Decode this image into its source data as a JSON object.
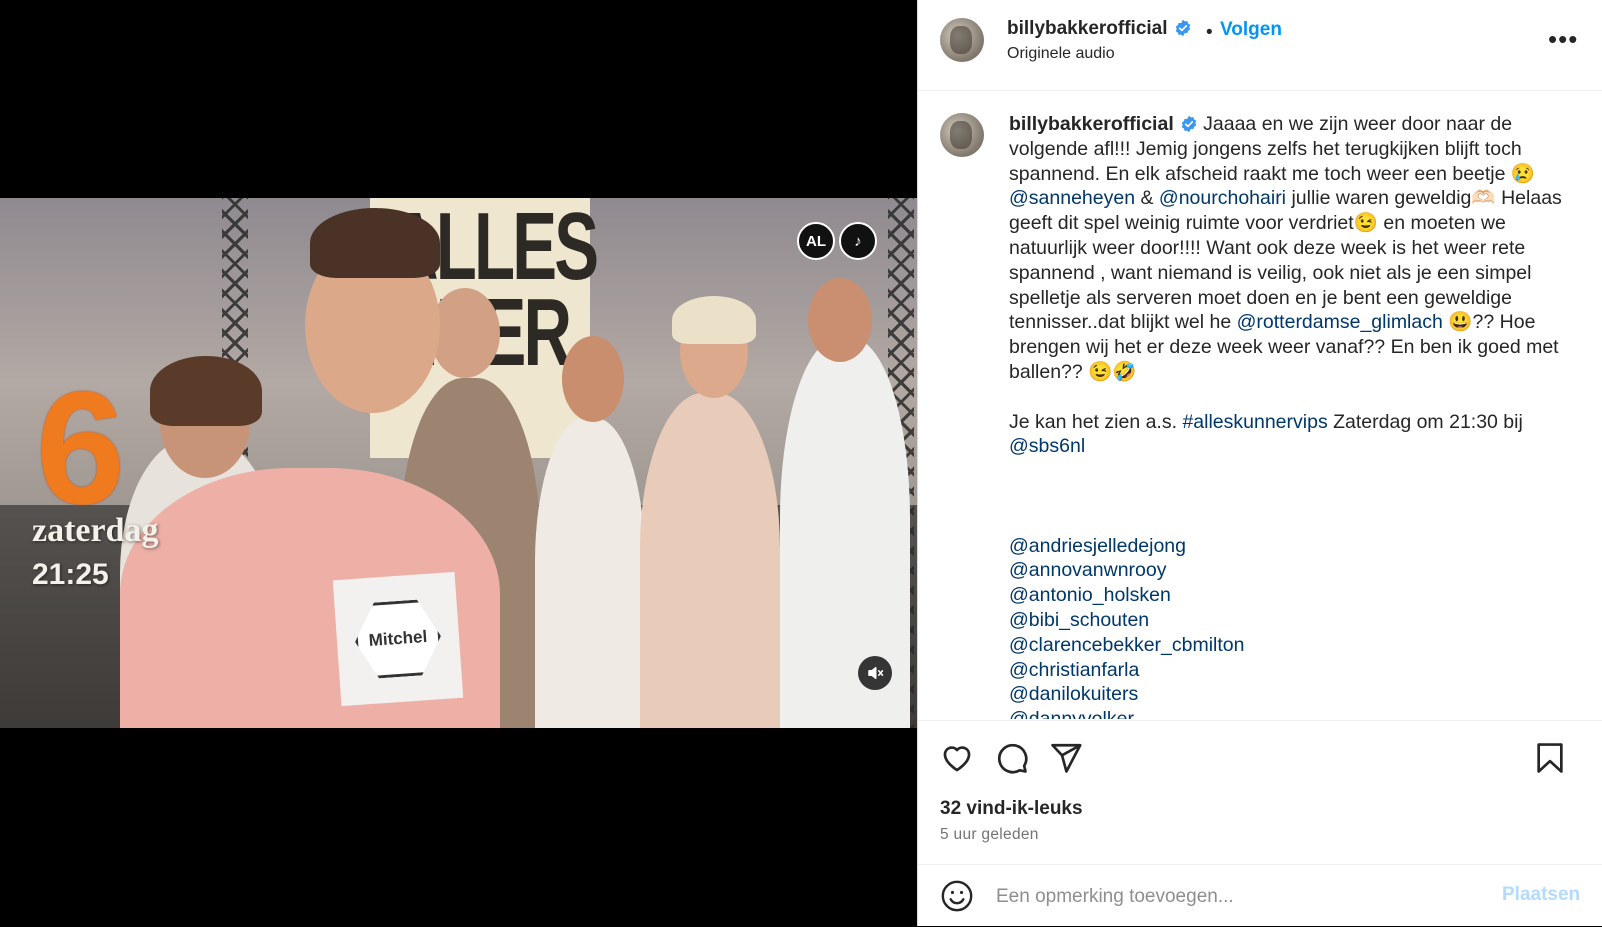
{
  "post": {
    "username": "billybakkerofficial",
    "separator": "•",
    "follow_label": "Volgen",
    "audio_label": "Originele audio",
    "more_label": "•••"
  },
  "video": {
    "channel_number": "6",
    "airing_day": "zaterdag",
    "airing_time": "21:25",
    "badge_left": "AL",
    "badge_right": "♪",
    "sign_text": "ALLES\nNNER",
    "name_tag": "Mitchel"
  },
  "caption": {
    "username": "billybakkerofficial",
    "p1": " Jaaaa en we zijn weer door naar de volgende afl!!! Jemig jongens zelfs het terugkijken blijft toch spannend. En elk afscheid raakt me toch weer een beetje 😢",
    "m1": "@sanneheyen",
    "amp": " & ",
    "m2": "@nourchohairi",
    "p2": " jullie waren geweldig🫶🏻 Helaas geeft dit spel weinig ruimte voor verdriet😉 en moeten we natuurlijk weer door!!!! Want ook deze week is het weer rete spannend , want niemand is veilig, ook niet als je een simpel spelletje als serveren moet doen en je bent een geweldige tennisser..dat blijkt wel he ",
    "m3": "@rotterdamse_glimlach",
    "p3": " 😃?? Hoe brengen wij het er deze week weer vanaf?? En ben ik goed met ballen?? 😉🤣",
    "p4": "Je kan het zien a.s. ",
    "hashtag": "#alleskunnervips",
    "p5": " Zaterdag om 21:30 bij ",
    "m4": "@sbs6nl",
    "tags": [
      "@andriesjelledejong",
      "@annovanwnrooy",
      "@antonio_holsken",
      "@bibi_schouten",
      "@clarencebekker_cbmilton",
      "@christianfarla",
      "@danilokuiters",
      "@dannyvolker"
    ]
  },
  "stats": {
    "likes": "32 vind-ik-leuks",
    "time_ago": "5 uur geleden"
  },
  "composer": {
    "placeholder": "Een opmerking toevoegen...",
    "post_label": "Plaatsen"
  },
  "colors": {
    "link": "#00376b",
    "follow": "#0095f6",
    "verified": "#3897f0",
    "post_disabled": "#b3dbff"
  },
  "icons": [
    "verified-badge-icon",
    "more-icon",
    "heart-icon",
    "comment-icon",
    "share-icon",
    "bookmark-icon",
    "emoji-icon",
    "mute-icon"
  ]
}
